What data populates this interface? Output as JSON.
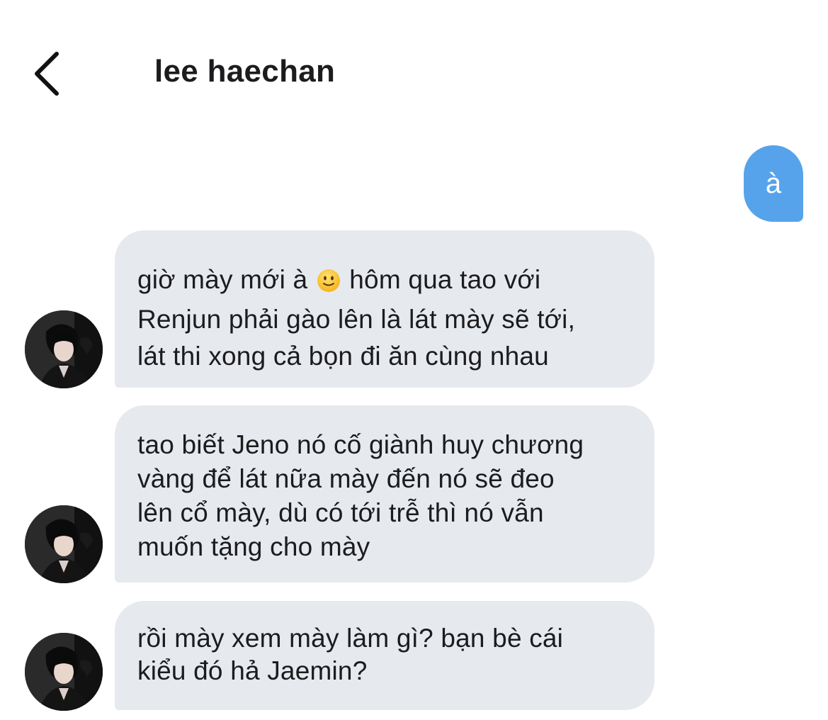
{
  "header": {
    "title": "lee haechan",
    "back_icon": "chevron-left-icon"
  },
  "sent": {
    "text": "à",
    "color": "#56a3eb"
  },
  "received": [
    {
      "lines": [
        "giờ mày mới à",
        "hôm qua tao với",
        "Renjun phải gào lên là lát mày sẽ tới,",
        "lát thi xong cả bọn đi ăn cùng nhau"
      ],
      "emoji": "slightly-smiling-face-icon"
    },
    {
      "lines": [
        "tao biết Jeno nó cố giành huy chương",
        "vàng để lát nữa mày đến nó sẽ đeo",
        "lên cổ mày, dù có tới trễ thì nó vẫn",
        "muốn tặng cho mày"
      ]
    },
    {
      "lines": [
        "rồi mày xem mày làm gì? bạn bè cái",
        "kiểu đó hả Jaemin?"
      ]
    }
  ],
  "colors": {
    "received_bubble": "#e6e9ee",
    "text": "#1c1c1e"
  }
}
